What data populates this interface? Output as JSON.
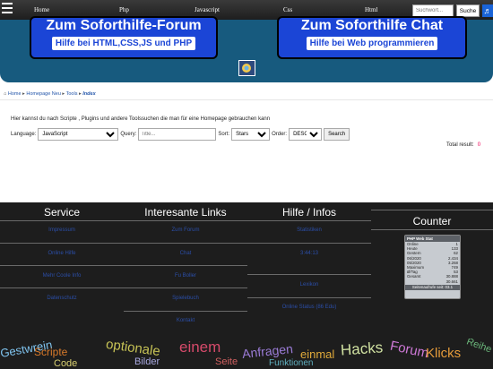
{
  "nav": {
    "items": [
      "Home",
      "Php",
      "Javascript",
      "Css",
      "Html"
    ],
    "search_placeholder": "Suchwort...",
    "search_button": "Suche",
    "music_icon": "music-note-icon"
  },
  "header": {
    "banner_left": {
      "title": "Zum Soforthilfe-Forum",
      "subtitle": "Hilfe bei HTML,CSS,JS und PHP"
    },
    "banner_right": {
      "title": "Zum Soforthilfe Chat",
      "subtitle": "Hilfe bei Web programmieren"
    }
  },
  "breadcrumb": [
    "Home",
    "Homepage Neu",
    "Tools",
    "Index"
  ],
  "main": {
    "intro": "Hier kannst du nach Scripte , Plugins und andere Toolssuchen die man für eine Homepage gebrauchen kann",
    "language_label": "Language:",
    "language_value": "JavaScript",
    "query_label": "Query:",
    "query_placeholder": "Title...",
    "sort_label": "Sort:",
    "sort_value": "Stars",
    "order_label": "Order:",
    "order_value": "DESC",
    "search_button": "Search",
    "total_label": "Total result:",
    "total_value": "0"
  },
  "footer": {
    "service": {
      "title": "Service",
      "links": [
        "Impressum",
        "Online Hilfe",
        "Mehr Coole Info",
        "Datenschutz"
      ]
    },
    "links": {
      "title": "Interesante Links",
      "links": [
        "Zum Forum",
        "Chat",
        "Fu Boller",
        "Spielebuch",
        "Kontakt"
      ]
    },
    "help": {
      "title": "Hilfe / Infos",
      "links": [
        "Statistiken",
        "3:44:13",
        "Lexikon",
        "Online Status (86 Edu)"
      ]
    },
    "counter": {
      "title": "Counter",
      "head": "PHP Web Stat",
      "rows": [
        [
          "Online",
          "1"
        ],
        [
          "Heute",
          "133"
        ],
        [
          "Gestern",
          "62"
        ],
        [
          "06/2020",
          "2.434"
        ],
        [
          "05/2020",
          "3.268"
        ],
        [
          "Maximum",
          "749"
        ],
        [
          "Ø/Tag",
          "53"
        ],
        [
          "Gesamt",
          "30.888"
        ],
        [
          "",
          "30.661"
        ]
      ],
      "foot": "Seitenaufrufe seit: 03.1"
    }
  },
  "cloud": [
    {
      "text": "Gestwrein",
      "color": "#7fc3ee"
    },
    {
      "text": "Scripte",
      "color": "#d97a2a"
    },
    {
      "text": "optionale",
      "color": "#c6c255"
    },
    {
      "text": "einem",
      "color": "#d54a6a"
    },
    {
      "text": "Anfragen",
      "color": "#9a7bd6"
    },
    {
      "text": "einmal",
      "color": "#e0aa3a"
    },
    {
      "text": "Hacks",
      "color": "#cfe0a0"
    },
    {
      "text": "Forum",
      "color": "#cf79d8"
    },
    {
      "text": "Klicks",
      "color": "#e59b3a"
    },
    {
      "text": "Reihe",
      "color": "#6ab57a"
    },
    {
      "text": "Bilder",
      "color": "#a8a8e0"
    },
    {
      "text": "Seite",
      "color": "#d06060"
    },
    {
      "text": "Funktionen",
      "color": "#60b0c0"
    },
    {
      "text": "Code",
      "color": "#d9d070"
    }
  ]
}
